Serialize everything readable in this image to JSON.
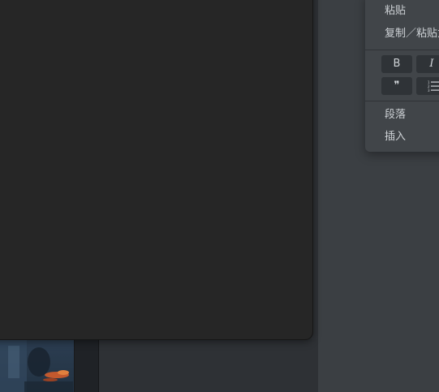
{
  "context_menu": {
    "paste_label": "粘贴",
    "copy_paste_as_label": "复制／粘贴为",
    "format_buttons": {
      "bold": "B",
      "italic": "I",
      "quote": "❞"
    },
    "paragraph_label": "段落",
    "insert_label": "插入"
  },
  "icons": {
    "quote": "quote-icon",
    "list": "ordered-list-icon"
  },
  "colors": {
    "menu_bg": "#414549",
    "editor_bg": "#262626",
    "window_bg": "#2f3236"
  }
}
